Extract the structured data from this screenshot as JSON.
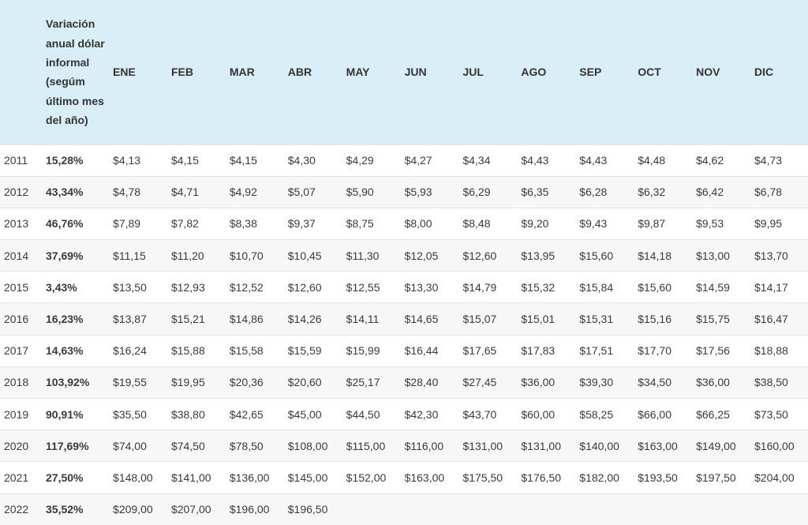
{
  "table": {
    "headers": {
      "year": "",
      "variation": "Variación anual dólar informal (segúm último mes del año)",
      "months": [
        "ENE",
        "FEB",
        "MAR",
        "ABR",
        "MAY",
        "JUN",
        "JUL",
        "AGO",
        "SEP",
        "OCT",
        "NOV",
        "DIC"
      ]
    },
    "rows": [
      {
        "year": "2011",
        "variation": "15,28%",
        "values": [
          "$4,13",
          "$4,15",
          "$4,15",
          "$4,30",
          "$4,29",
          "$4,27",
          "$4,34",
          "$4,43",
          "$4,43",
          "$4,48",
          "$4,62",
          "$4,73"
        ]
      },
      {
        "year": "2012",
        "variation": "43,34%",
        "values": [
          "$4,78",
          "$4,71",
          "$4,92",
          "$5,07",
          "$5,90",
          "$5,93",
          "$6,29",
          "$6,35",
          "$6,28",
          "$6,32",
          "$6,42",
          "$6,78"
        ]
      },
      {
        "year": "2013",
        "variation": "46,76%",
        "values": [
          "$7,89",
          "$7,82",
          "$8,38",
          "$9,37",
          "$8,75",
          "$8,00",
          "$8,48",
          "$9,20",
          "$9,43",
          "$9,87",
          "$9,53",
          "$9,95"
        ]
      },
      {
        "year": "2014",
        "variation": "37,69%",
        "values": [
          "$11,15",
          "$11,20",
          "$10,70",
          "$10,45",
          "$11,30",
          "$12,05",
          "$12,60",
          "$13,95",
          "$15,60",
          "$14,18",
          "$13,00",
          "$13,70"
        ]
      },
      {
        "year": "2015",
        "variation": "3,43%",
        "values": [
          "$13,50",
          "$12,93",
          "$12,52",
          "$12,60",
          "$12,55",
          "$13,30",
          "$14,79",
          "$15,32",
          "$15,84",
          "$15,60",
          "$14,59",
          "$14,17"
        ]
      },
      {
        "year": "2016",
        "variation": "16,23%",
        "values": [
          "$13,87",
          "$15,21",
          "$14,86",
          "$14,26",
          "$14,11",
          "$14,65",
          "$15,07",
          "$15,01",
          "$15,31",
          "$15,16",
          "$15,75",
          "$16,47"
        ]
      },
      {
        "year": "2017",
        "variation": "14,63%",
        "values": [
          "$16,24",
          "$15,88",
          "$15,58",
          "$15,59",
          "$15,99",
          "$16,44",
          "$17,65",
          "$17,83",
          "$17,51",
          "$17,70",
          "$17,56",
          "$18,88"
        ]
      },
      {
        "year": "2018",
        "variation": "103,92%",
        "values": [
          "$19,55",
          "$19,95",
          "$20,36",
          "$20,60",
          "$25,17",
          "$28,40",
          "$27,45",
          "$36,00",
          "$39,30",
          "$34,50",
          "$36,00",
          "$38,50"
        ]
      },
      {
        "year": "2019",
        "variation": "90,91%",
        "values": [
          "$35,50",
          "$38,80",
          "$42,65",
          "$45,00",
          "$44,50",
          "$42,30",
          "$43,70",
          "$60,00",
          "$58,25",
          "$66,00",
          "$66,25",
          "$73,50"
        ]
      },
      {
        "year": "2020",
        "variation": "117,69%",
        "values": [
          "$74,00",
          "$74,50",
          "$78,50",
          "$108,00",
          "$115,00",
          "$116,00",
          "$131,00",
          "$131,00",
          "$140,00",
          "$163,00",
          "$149,00",
          "$160,00"
        ]
      },
      {
        "year": "2021",
        "variation": "27,50%",
        "values": [
          "$148,00",
          "$141,00",
          "$136,00",
          "$145,00",
          "$152,00",
          "$163,00",
          "$175,50",
          "$176,50",
          "$182,00",
          "$193,50",
          "$197,50",
          "$204,00"
        ]
      },
      {
        "year": "2022",
        "variation": "35,52%",
        "values": [
          "$209,00",
          "$207,00",
          "$196,00",
          "$196,50",
          "",
          "",
          "",
          "",
          "",
          "",
          "",
          ""
        ]
      }
    ]
  }
}
